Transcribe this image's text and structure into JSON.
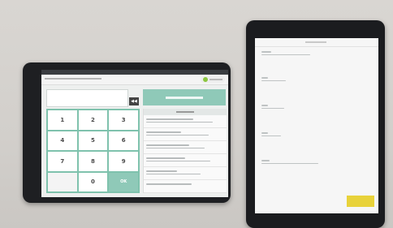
{
  "scene": {
    "description_free": true,
    "colors": {
      "background": "#d6d3cf",
      "device_bezel": "#1e1f22",
      "accent_teal": "#8fc9b8",
      "accent_yellow": "#e8d23a",
      "status_green": "#8cc63f"
    }
  },
  "tablet_a": {
    "keypad": {
      "keys": [
        "1",
        "2",
        "3",
        "4",
        "5",
        "6",
        "7",
        "8",
        "9",
        "",
        "0",
        "OK"
      ]
    },
    "clear_label": "◀◀"
  },
  "tablet_b": {}
}
